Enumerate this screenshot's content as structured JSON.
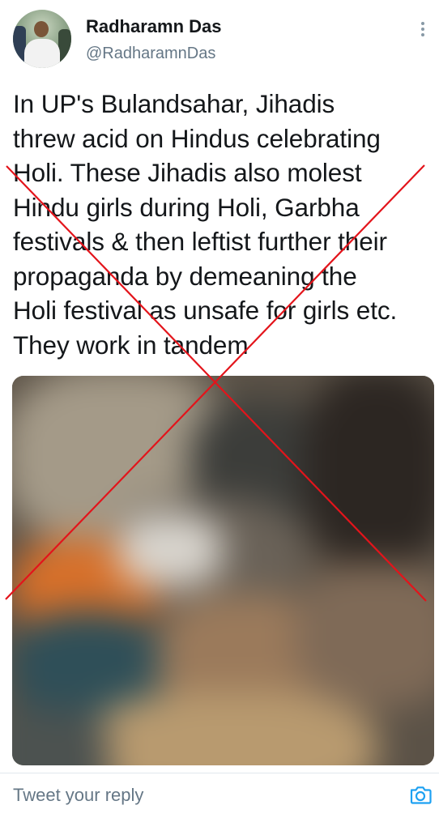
{
  "author": {
    "display_name": "Radharamn Das",
    "handle": "@RadharamnDas"
  },
  "tweet": {
    "text": "In UP's Bulandsahar, Jihadis\nthrew acid on Hindus celebrating\nHoli. These Jihadis also  molest\nHindu girls during Holi, Garbha\nfestivals & then leftist further their\npropaganda by demeaning the\nHoli festival as unsafe for girls etc.\nThey work in tandem"
  },
  "reply": {
    "placeholder": "Tweet your reply"
  },
  "colors": {
    "accent": "#1da1f2",
    "cross": "#e3141b",
    "secondary_text": "#657786"
  },
  "icons": {
    "more": "more-vertical-icon",
    "camera": "camera-icon"
  }
}
